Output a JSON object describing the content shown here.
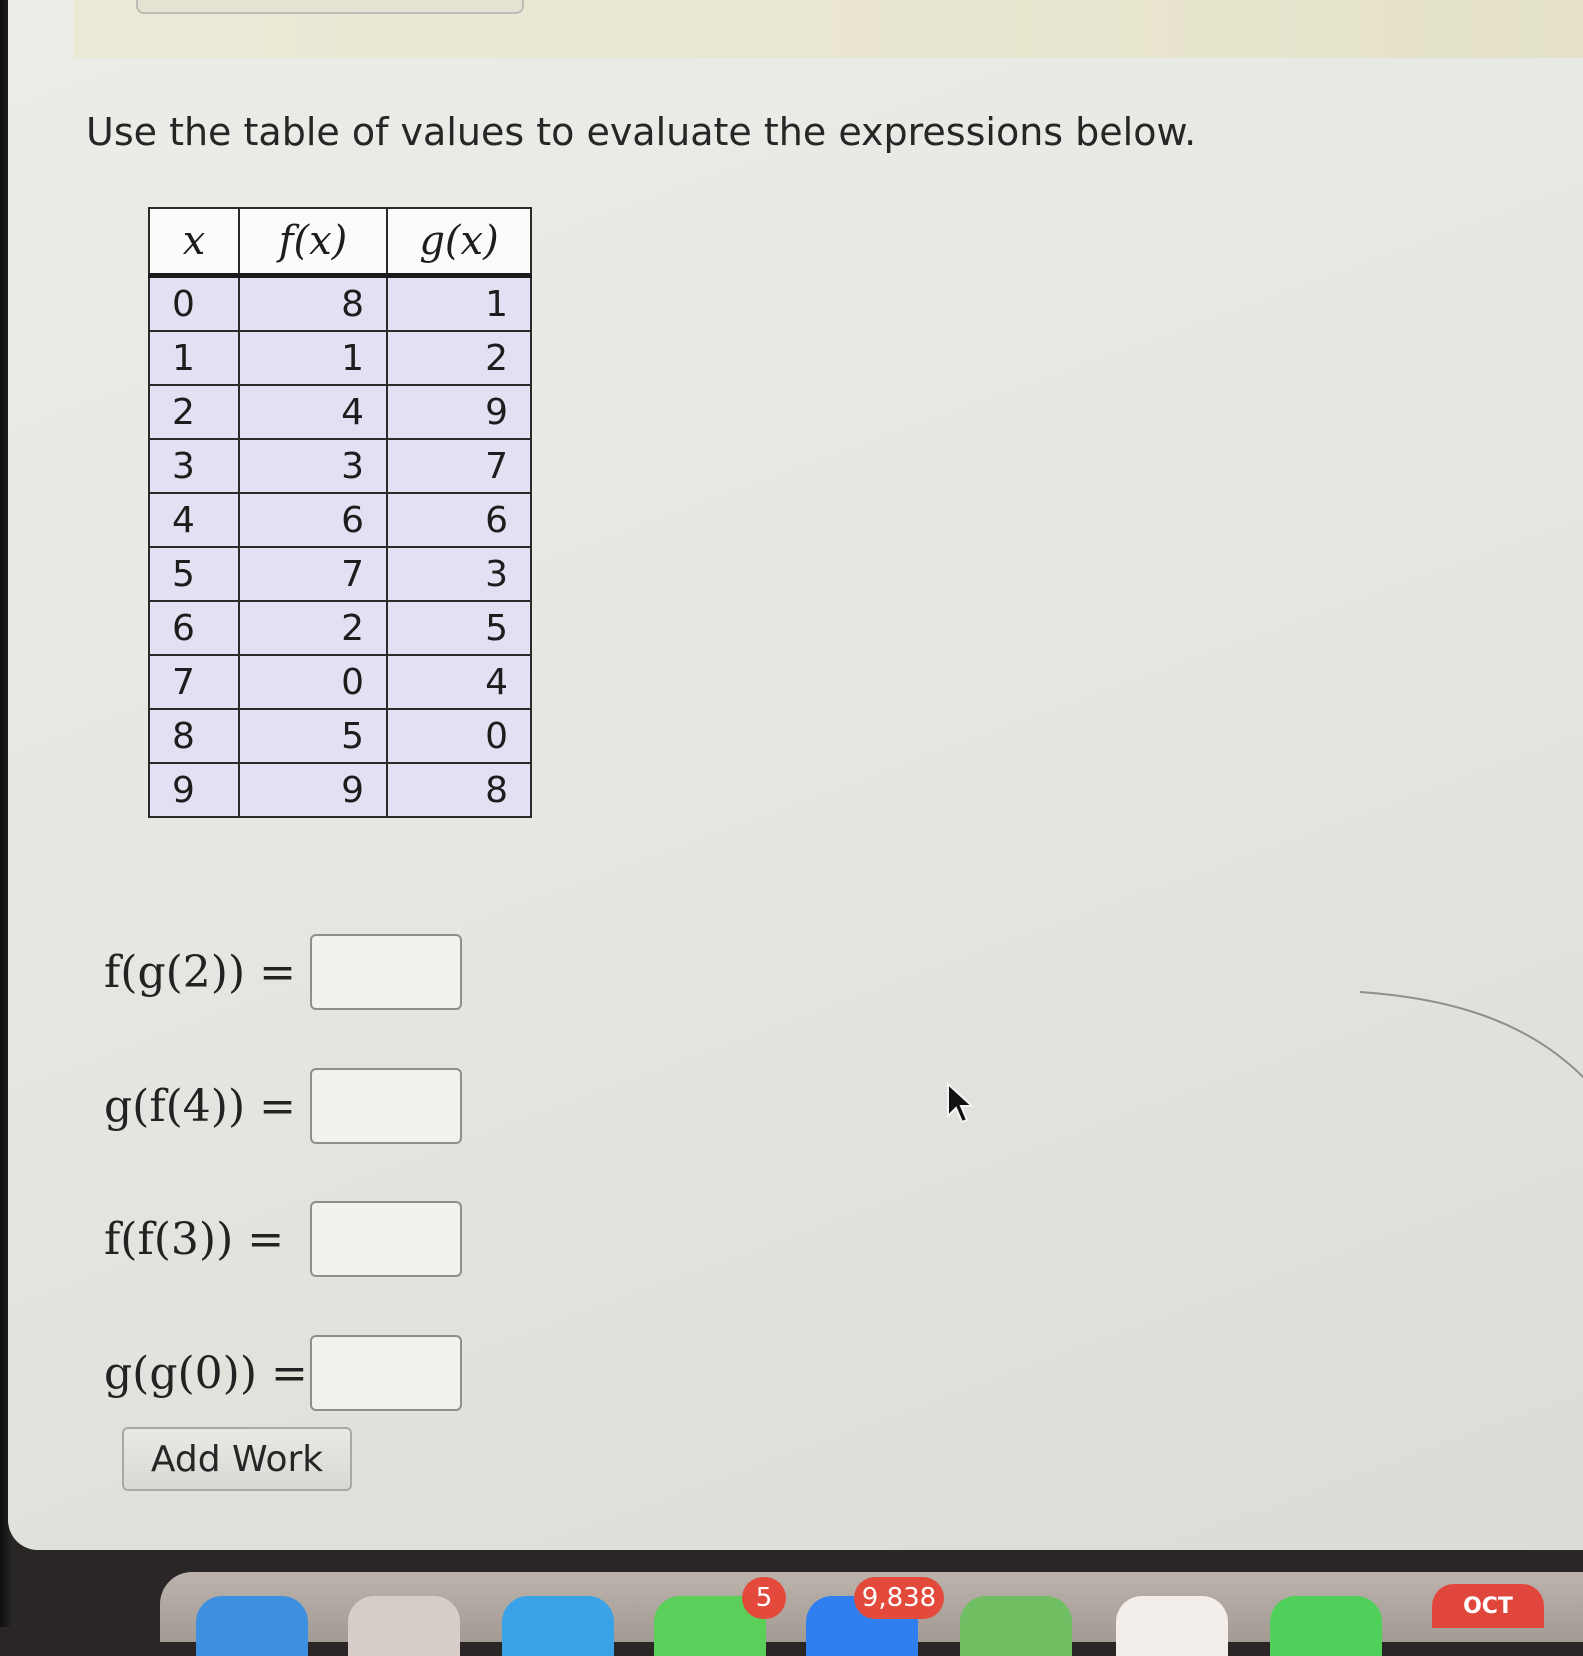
{
  "instructions": "Use the table of values to evaluate the expressions below.",
  "table": {
    "headers": [
      "x",
      "f(x)",
      "g(x)"
    ],
    "rows": [
      [
        "0",
        "8",
        "1"
      ],
      [
        "1",
        "1",
        "2"
      ],
      [
        "2",
        "4",
        "9"
      ],
      [
        "3",
        "3",
        "7"
      ],
      [
        "4",
        "6",
        "6"
      ],
      [
        "5",
        "7",
        "3"
      ],
      [
        "6",
        "2",
        "5"
      ],
      [
        "7",
        "0",
        "4"
      ],
      [
        "8",
        "5",
        "0"
      ],
      [
        "9",
        "9",
        "8"
      ]
    ]
  },
  "expressions": [
    {
      "label": "f(g(2)) =",
      "value": ""
    },
    {
      "label": "g(f(4)) =",
      "value": ""
    },
    {
      "label": "f(f(3)) =",
      "value": ""
    },
    {
      "label": "g(g(0)) =",
      "value": ""
    }
  ],
  "add_work_label": "Add Work",
  "dock": {
    "badge_messages": "5",
    "badge_mail": "9,838",
    "calendar_month": "OCT"
  },
  "colors": {
    "table_cell_bg": "#e1e1f3",
    "badge_red": "#e34a3b"
  }
}
